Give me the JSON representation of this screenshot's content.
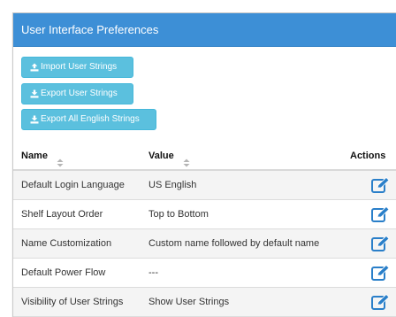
{
  "panel": {
    "title": "User Interface Preferences"
  },
  "buttons": {
    "import_label": "Import User Strings",
    "export_label": "Export User Strings",
    "export_all_label": "Export All English Strings"
  },
  "table": {
    "headers": {
      "name": "Name",
      "value": "Value",
      "actions": "Actions"
    },
    "rows": [
      {
        "name": "Default Login Language",
        "value": "US English"
      },
      {
        "name": "Shelf Layout Order",
        "value": "Top to Bottom"
      },
      {
        "name": "Name Customization",
        "value": "Custom name followed by default name"
      },
      {
        "name": "Default Power Flow",
        "value": "---"
      },
      {
        "name": "Visibility of User Strings",
        "value": "Show User Strings"
      }
    ]
  },
  "colors": {
    "header_bg": "#3d8fd6",
    "button_bg": "#5bc0de",
    "edit_icon": "#2a7fc9"
  },
  "icons": {
    "upload": "upload-icon",
    "download": "download-icon",
    "sort": "sort-icon",
    "edit": "edit-icon"
  }
}
